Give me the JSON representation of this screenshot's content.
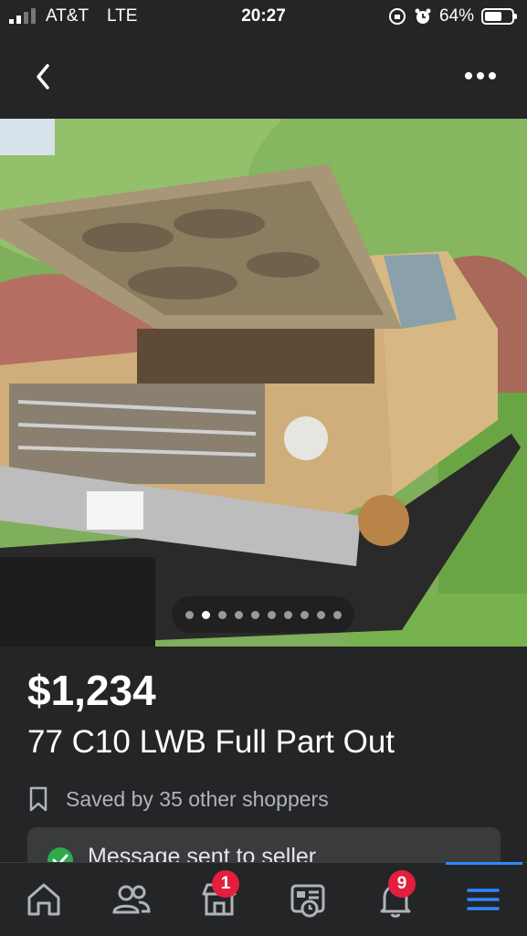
{
  "status_bar": {
    "carrier": "AT&T",
    "network": "LTE",
    "time": "20:27",
    "battery": "64%",
    "battery_level": 0.64
  },
  "nav": {
    "back_icon": "chevron-left-icon",
    "more_icon": "more-horizontal-icon"
  },
  "gallery": {
    "photo_count": 10,
    "current_index": 2
  },
  "listing": {
    "price": "$1,234",
    "title": "77 C10 LWB Full Part Out",
    "saved_text": "Saved by 35 other shoppers"
  },
  "message_card": {
    "text": "Message sent to seller"
  },
  "tabs": [
    {
      "icon": "home-icon",
      "badge": ""
    },
    {
      "icon": "friends-icon",
      "badge": ""
    },
    {
      "icon": "marketplace-icon",
      "badge": "1"
    },
    {
      "icon": "news-icon",
      "badge": ""
    },
    {
      "icon": "bell-icon",
      "badge": "9"
    },
    {
      "icon": "menu-icon",
      "badge": ""
    }
  ],
  "colors": {
    "background": "#242526",
    "accent": "#2d88ff",
    "badge": "#e41e3f",
    "success": "#2ea94d"
  }
}
